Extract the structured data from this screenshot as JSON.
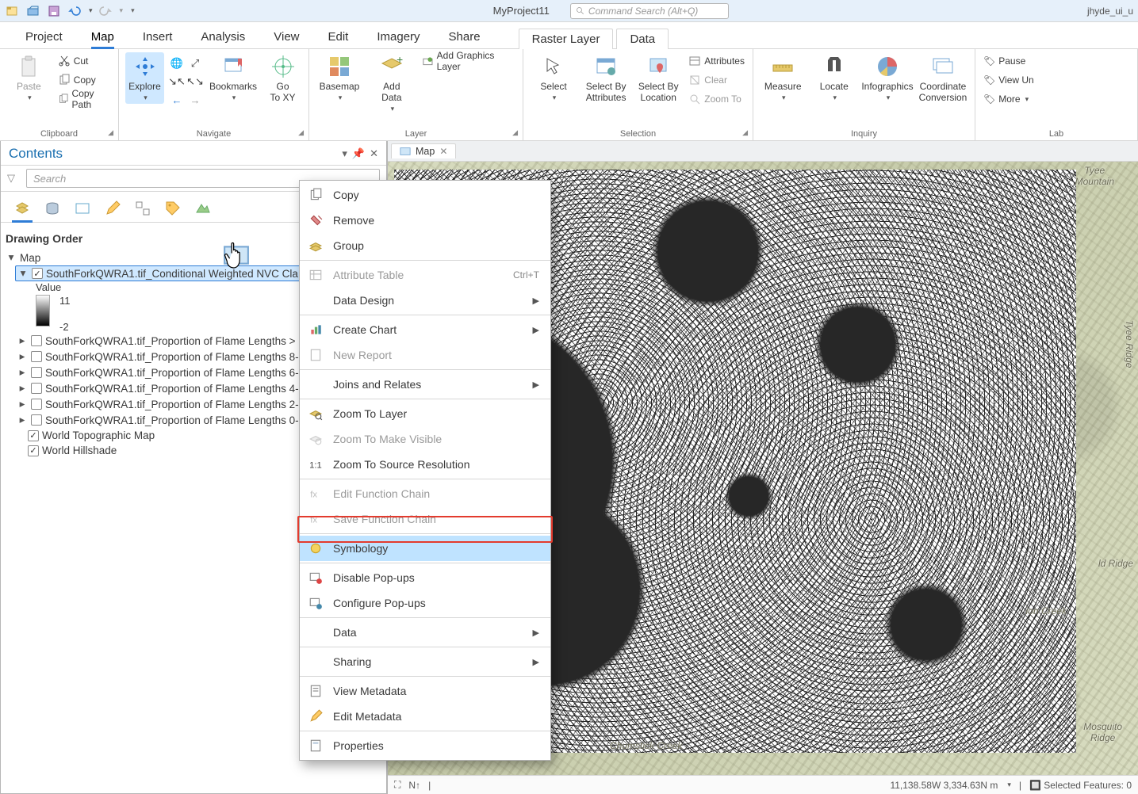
{
  "qat": {
    "project_title": "MyProject11",
    "search_placeholder": "Command Search (Alt+Q)",
    "user": "jhyde_ui_u"
  },
  "tabs": {
    "items": [
      "Project",
      "Map",
      "Insert",
      "Analysis",
      "View",
      "Edit",
      "Imagery",
      "Share"
    ],
    "active": "Map",
    "contextual": [
      "Raster Layer",
      "Data"
    ]
  },
  "ribbon": {
    "clipboard": {
      "label": "Clipboard",
      "paste": "Paste",
      "cut": "Cut",
      "copy": "Copy",
      "copypath": "Copy Path"
    },
    "navigate": {
      "label": "Navigate",
      "explore": "Explore",
      "bookmarks": "Bookmarks",
      "goto": "Go\nTo XY"
    },
    "layer": {
      "label": "Layer",
      "basemap": "Basemap",
      "adddata": "Add\nData",
      "addgraphics": "Add Graphics Layer"
    },
    "selection": {
      "label": "Selection",
      "select": "Select",
      "byattr": "Select By\nAttributes",
      "byloc": "Select By\nLocation",
      "attributes": "Attributes",
      "clear": "Clear",
      "zoomto": "Zoom To"
    },
    "inquiry": {
      "label": "Inquiry",
      "measure": "Measure",
      "locate": "Locate",
      "infographics": "Infographics",
      "coord": "Coordinate\nConversion"
    },
    "labeling": {
      "label": "Lab",
      "pause": "Pause",
      "viewun": "View Un",
      "more": "More"
    }
  },
  "contents": {
    "title": "Contents",
    "search_placeholder": "Search",
    "section": "Drawing Order",
    "map_node": "Map",
    "selected_layer": "SouthForkQWRA1.tif_Conditional Weighted NVC Cla",
    "value_label": "Value",
    "ramp_max": "11",
    "ramp_min": "-2",
    "layers": [
      "SouthForkQWRA1.tif_Proportion of Flame Lengths >",
      "SouthForkQWRA1.tif_Proportion of Flame Lengths 8-",
      "SouthForkQWRA1.tif_Proportion of Flame Lengths 6-",
      "SouthForkQWRA1.tif_Proportion of Flame Lengths 4-",
      "SouthForkQWRA1.tif_Proportion of Flame Lengths 2-",
      "SouthForkQWRA1.tif_Proportion of Flame Lengths 0-"
    ],
    "base_layers": [
      "World Topographic Map",
      "World Hillshade"
    ]
  },
  "context_menu": {
    "items": [
      {
        "icon": "copy",
        "label": "Copy"
      },
      {
        "icon": "remove",
        "label": "Remove"
      },
      {
        "icon": "group",
        "label": "Group"
      },
      {
        "sep": true
      },
      {
        "icon": "table",
        "label": "Attribute Table",
        "hotkey": "Ctrl+T",
        "disabled": true
      },
      {
        "label": "Data Design",
        "submenu": true
      },
      {
        "sep": true
      },
      {
        "icon": "chart",
        "label": "Create Chart",
        "submenu": true
      },
      {
        "icon": "report",
        "label": "New Report",
        "disabled": true
      },
      {
        "sep": true
      },
      {
        "label": "Joins and Relates",
        "submenu": true
      },
      {
        "sep": true
      },
      {
        "icon": "zoom",
        "label": "Zoom To Layer"
      },
      {
        "icon": "zoomvis",
        "label": "Zoom To Make Visible",
        "disabled": true
      },
      {
        "icon": "oneone",
        "label": "Zoom To Source Resolution"
      },
      {
        "sep": true
      },
      {
        "icon": "fx",
        "label": "Edit Function Chain",
        "disabled": true
      },
      {
        "icon": "fxsave",
        "label": "Save Function Chain",
        "disabled": true
      },
      {
        "sep": true
      },
      {
        "icon": "symb",
        "label": "Symbology",
        "highlight": true
      },
      {
        "sep": true
      },
      {
        "icon": "popoff",
        "label": "Disable Pop-ups"
      },
      {
        "icon": "popcfg",
        "label": "Configure Pop-ups"
      },
      {
        "sep": true
      },
      {
        "label": "Data",
        "submenu": true
      },
      {
        "sep": true
      },
      {
        "label": "Sharing",
        "submenu": true
      },
      {
        "sep": true
      },
      {
        "icon": "meta",
        "label": "View Metadata"
      },
      {
        "icon": "metaedit",
        "label": "Edit Metadata"
      },
      {
        "sep": true
      },
      {
        "icon": "props",
        "label": "Properties"
      }
    ]
  },
  "mapview": {
    "tab": "Map",
    "labels": {
      "tyee_mtn": "Tyee\nMountain",
      "tyee_ridge": "Tyee Ridge",
      "ld_ridge": "ld Ridge",
      "mosquito": "Mosquito\nRidge",
      "chumstick": "Chumstick Creek",
      "ioncreek": "ion Creek"
    },
    "coords": "11,138.58W 3,334.63N m",
    "selected": "Selected Features: 0"
  }
}
